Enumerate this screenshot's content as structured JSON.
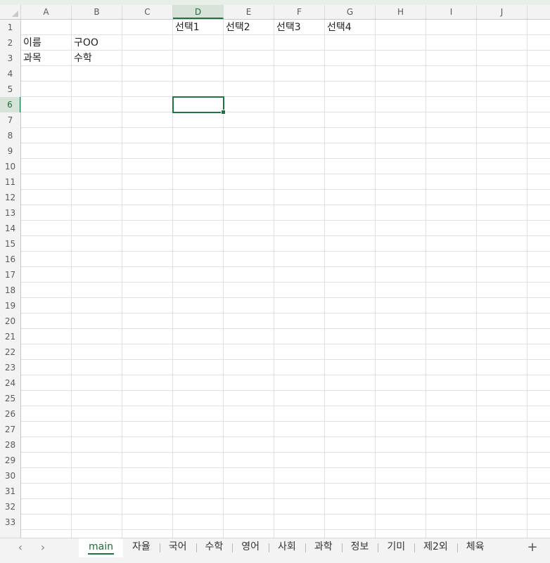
{
  "columns": [
    "A",
    "B",
    "C",
    "D",
    "E",
    "F",
    "G",
    "H",
    "I",
    "J"
  ],
  "active_column": "D",
  "rows": [
    "1",
    "2",
    "3",
    "4",
    "5",
    "6",
    "7",
    "8",
    "9",
    "10",
    "11",
    "12",
    "13",
    "14",
    "15",
    "16",
    "17",
    "18",
    "19",
    "20",
    "21",
    "22",
    "23",
    "24",
    "25",
    "26",
    "27",
    "28",
    "29",
    "30",
    "31",
    "32",
    "33"
  ],
  "active_row": "6",
  "cells": {
    "D1": "선택1",
    "E1": "선택2",
    "F1": "선택3",
    "G1": "선택4",
    "A2": "이름",
    "B2": "구OO",
    "A3": "과목",
    "B3": "수학"
  },
  "selected_cell": "D6",
  "sheet_tabs": [
    "main",
    "자율",
    "국어",
    "수학",
    "영어",
    "사회",
    "과학",
    "정보",
    "기미",
    "제2외",
    "체육"
  ],
  "active_tab": "main",
  "icons": {
    "prev": "chevron-left-icon",
    "next": "chevron-right-icon",
    "add": "plus-icon"
  },
  "colors": {
    "accent": "#1f7244",
    "header_bg": "#f3f3f3",
    "grid_line": "#e1e1e1"
  }
}
